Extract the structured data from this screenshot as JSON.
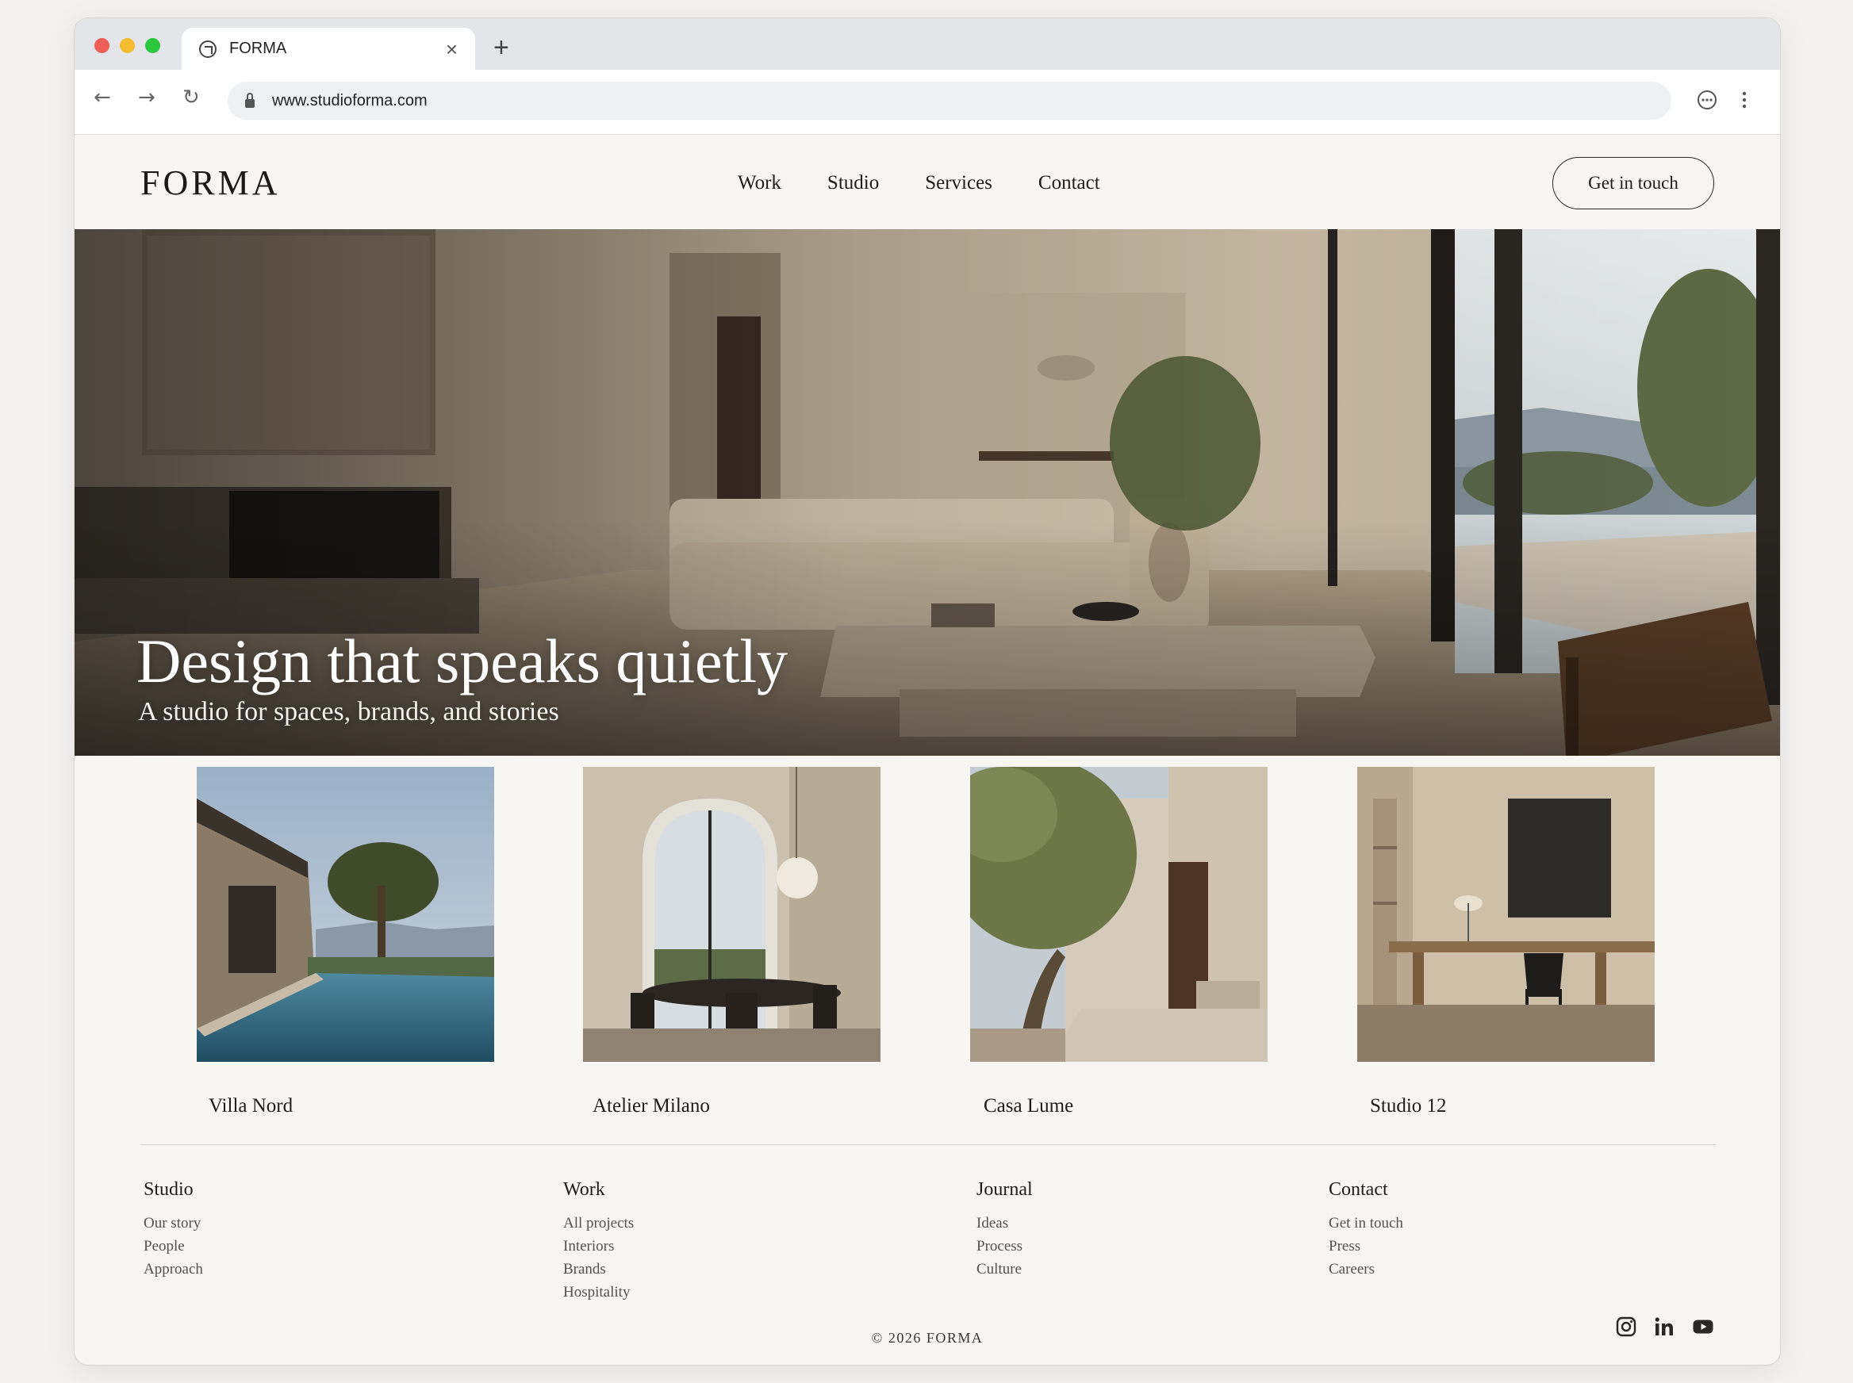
{
  "browser": {
    "tab_title": "FORMA",
    "url": "www.studioforma.com"
  },
  "header": {
    "logo": "FORMA",
    "nav": [
      "Work",
      "Studio",
      "Services",
      "Contact"
    ],
    "cta": "Get in touch"
  },
  "hero": {
    "title": "Design that speaks quietly",
    "subtitle": "A studio for spaces, brands, and stories"
  },
  "projects": [
    {
      "name": "Villa Nord"
    },
    {
      "name": "Atelier Milano"
    },
    {
      "name": "Casa Lume"
    },
    {
      "name": "Studio 12"
    }
  ],
  "footer": {
    "columns": [
      {
        "heading": "Studio",
        "links": [
          "Our story",
          "People",
          "Approach"
        ]
      },
      {
        "heading": "Work",
        "links": [
          "All projects",
          "Interiors",
          "Brands",
          "Hospitality"
        ]
      },
      {
        "heading": "Journal",
        "links": [
          "Ideas",
          "Process",
          "Culture"
        ]
      },
      {
        "heading": "Contact",
        "links": [
          "Get in touch",
          "Press",
          "Careers"
        ]
      }
    ],
    "copyright": "© 2026 FORMA",
    "social": [
      "instagram-icon",
      "linkedin-icon",
      "youtube-icon"
    ]
  },
  "colors": {
    "traffic_red": "#ed5f57",
    "traffic_yellow": "#f4bd2f",
    "traffic_green": "#2bc83f",
    "page_bg": "#f7f6f3",
    "text": "#1f1d1b"
  }
}
